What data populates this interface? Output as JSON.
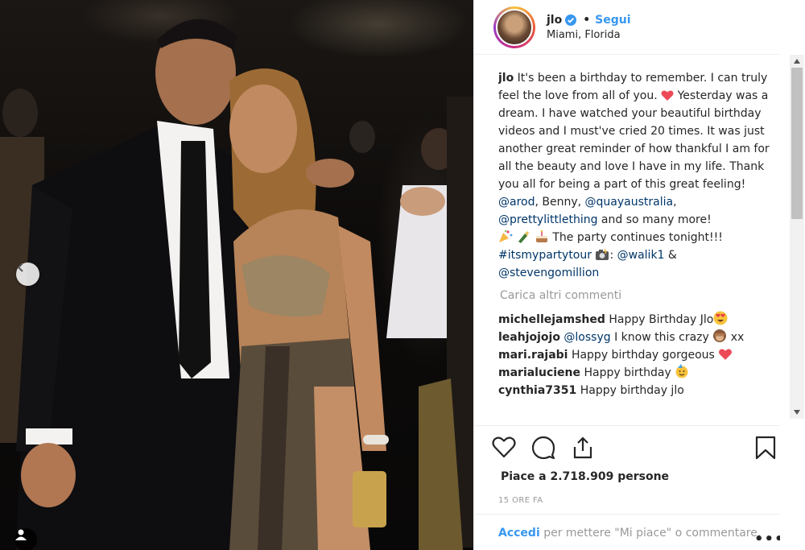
{
  "header": {
    "username": "jlo",
    "separator": "•",
    "follow_label": "Segui",
    "location": "Miami, Florida"
  },
  "caption": {
    "author": "jlo",
    "text_1": "It's been a birthday to remember. I can truly feel the love from all of you.",
    "text_2": "Yesterday was a dream. I have watched your beautiful birthday videos and I must've cried 20 times. It was just another great reminder of how thankful I am for all the beauty and love I have in my life. Thank you all for being a part of this great feeling!",
    "mention_arod": "@arod",
    "text_benny": ", Benny, ",
    "mention_quay": "@quayaustralia",
    "comma": ",",
    "mention_plt": "@prettylittlething",
    "text_more": " and so many more!",
    "text_party": " The party continues tonight!!!",
    "hashtag": "#itsmypartytour",
    "mention_walik": "@walik1",
    "amp": " & ",
    "mention_steven": "@stevengomillion"
  },
  "load_more_label": "Carica altri commenti",
  "comments": [
    {
      "user": "michellejamshed",
      "text": "Happy Birthday Jlo"
    },
    {
      "user": "leahjojojo",
      "mention": "@lossyg",
      "text": "I know this crazy",
      "suffix": "xx"
    },
    {
      "user": "mari.rajabi",
      "text": "Happy birthday gorgeous"
    },
    {
      "user": "marialuciene",
      "text": "Happy birthday"
    },
    {
      "user": "cynthia7351",
      "text": "Happy birthday jlo"
    }
  ],
  "likes": {
    "text": "Piace a 2.718.909 persone"
  },
  "timestamp": "15 ORE FA",
  "login": {
    "link": "Accedi",
    "text": "per mettere \"Mi piace\" o commentare."
  },
  "more_options": "•••",
  "colors": {
    "link_blue": "#3897f0",
    "mention_blue": "#003569",
    "heart_red": "#ed4956",
    "muted_gray": "#999999"
  }
}
